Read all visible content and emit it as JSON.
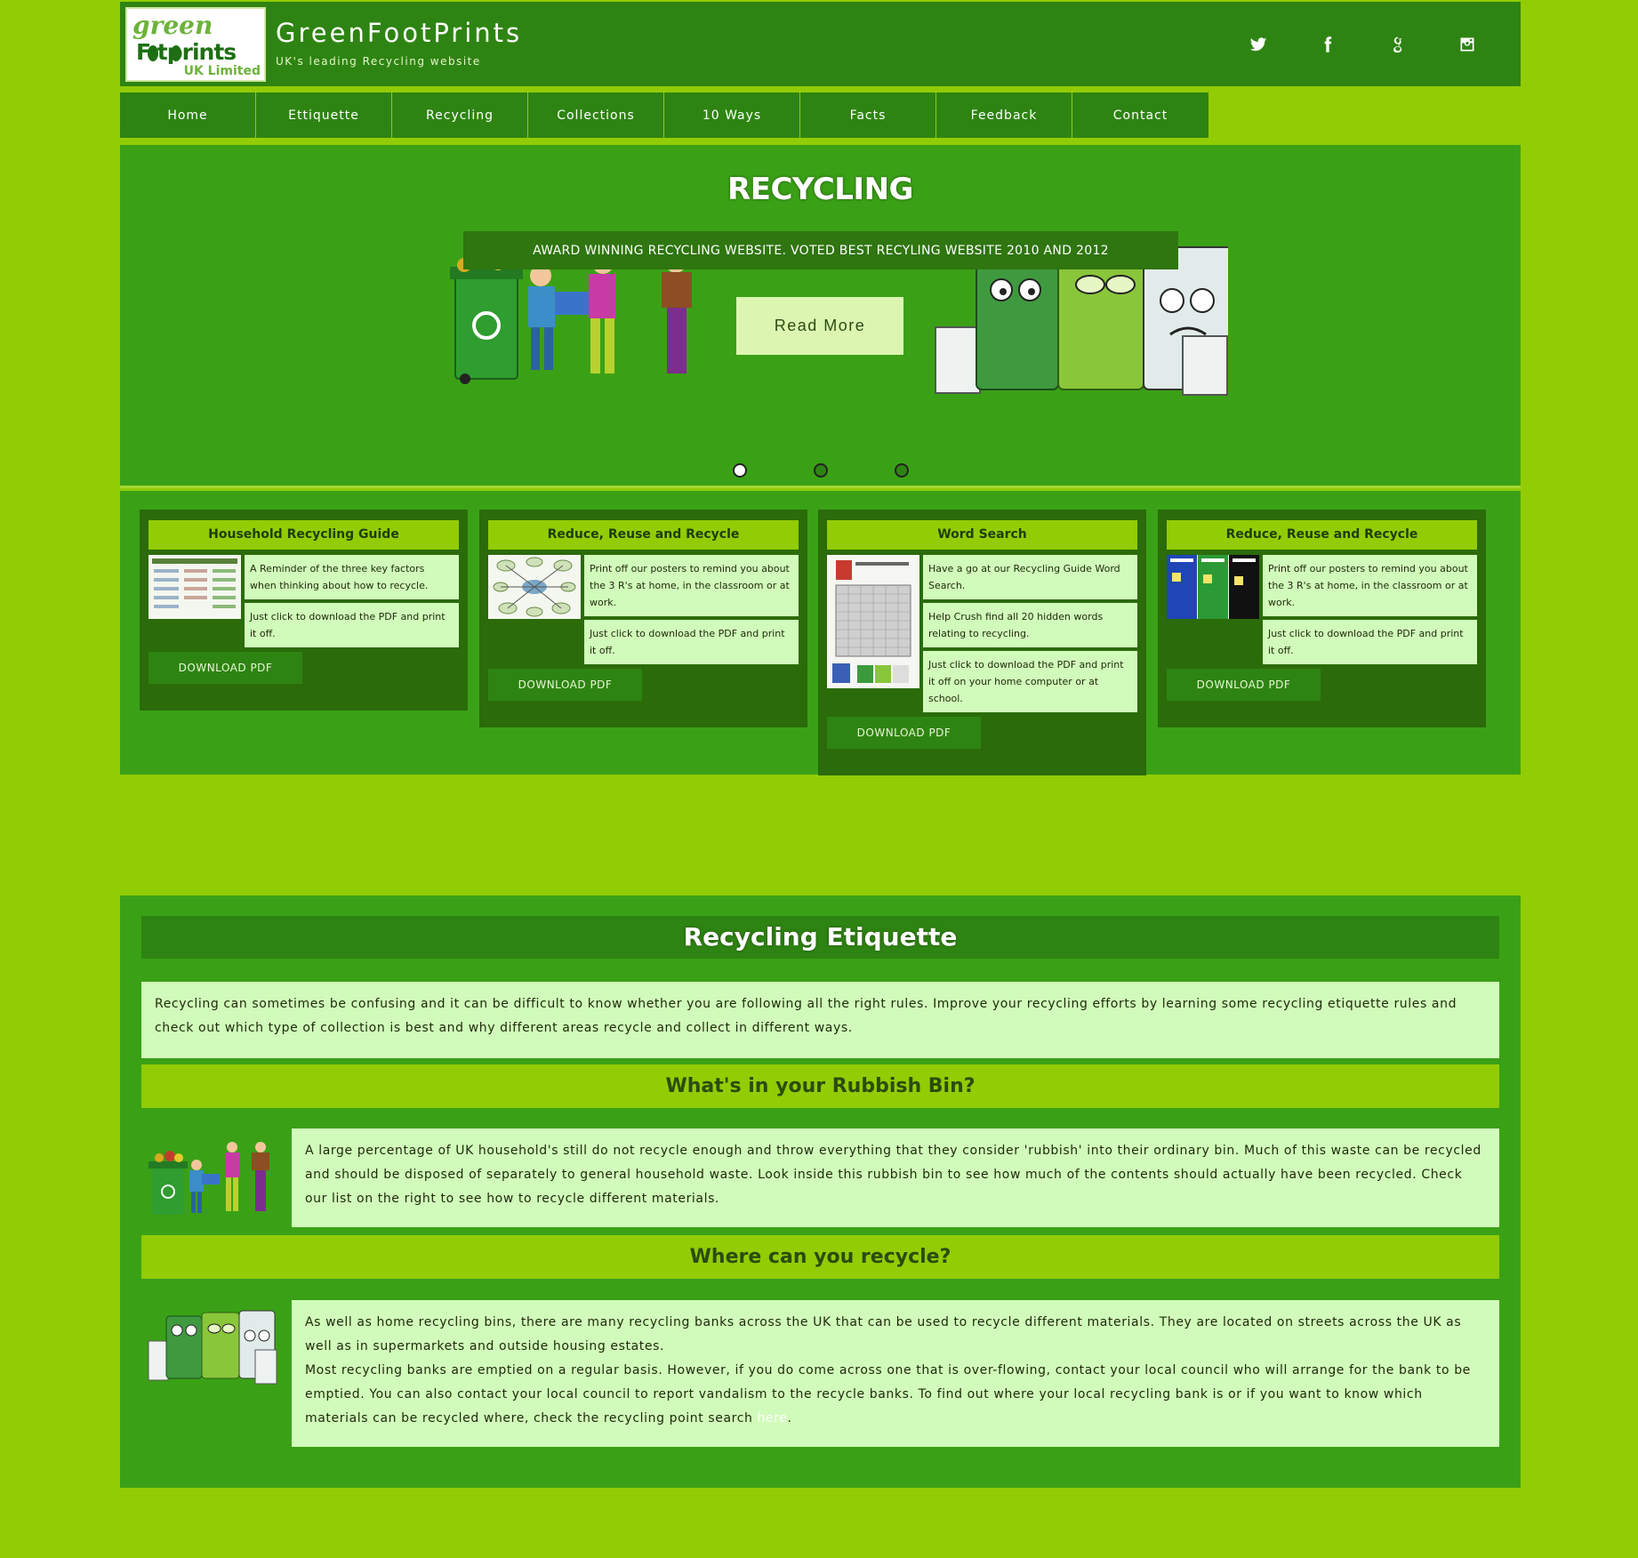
{
  "header": {
    "logo_top": "green",
    "logo_mid": "F  tprints",
    "logo_bottom": "UK Limited",
    "title": "GreenFootPrints",
    "subtitle": "UK's leading Recycling website",
    "social_icons": [
      "twitter-icon",
      "facebook-icon",
      "google-icon",
      "instagram-icon"
    ]
  },
  "nav": {
    "items": [
      "Home",
      "Ettiquette",
      "Recycling",
      "Collections",
      "10 Ways",
      "Facts",
      "Feedback",
      "Contact"
    ]
  },
  "hero": {
    "title": "RECYCLING",
    "banner": "AWARD WINNING RECYCLING WEBSITE. VOTED BEST RECYLING WEBSITE 2010 AND 2012",
    "button": "Read More",
    "active_slide": 1,
    "slide_count": 3
  },
  "cards": [
    {
      "title": "Household Recycling Guide",
      "texts": [
        "A Reminder of the three key factors when thinking about how to recycle.",
        "Just click to download the PDF and print it off."
      ],
      "button": "DOWNLOAD PDF"
    },
    {
      "title": "Reduce, Reuse and Recycle",
      "texts": [
        "Print off our posters to remind you about the 3 R's at home, in the classroom or at work.",
        "Just click to download the PDF and print it off."
      ],
      "button": "DOWNLOAD PDF"
    },
    {
      "title": "Word Search",
      "texts": [
        "Have a go at our Recycling Guide Word Search.",
        "Help Crush find all 20 hidden words relating to recycling.",
        "Just click to download the PDF and print it off on your home computer or at school."
      ],
      "button": "DOWNLOAD PDF"
    },
    {
      "title": "Reduce, Reuse and Recycle",
      "texts": [
        "Print off our posters to remind you about the 3 R's at home, in the classroom or at work.",
        "Just click to download the PDF and print it off."
      ],
      "button": "DOWNLOAD PDF"
    }
  ],
  "etiquette": {
    "title": "Recycling Etiquette",
    "intro": "Recycling can sometimes be confusing and it can be difficult to know whether you are following all the right rules. Improve your recycling efforts by learning some recycling etiquette rules and check out which type of collection is best and why different areas recycle and collect in different ways.",
    "rubbish_heading": "What's in your Rubbish Bin?",
    "rubbish_text": "A large percentage of UK household's still do not recycle enough and throw everything that they consider 'rubbish' into their ordinary bin. Much of this waste can be recycled and should be disposed of separately to general household waste. Look inside this rubbish bin to see how much of the contents should actually have been recycled. Check our list on the right to see how to recycle different materials.",
    "where_heading": "Where can you recycle?",
    "where_text_1": "As well as home recycling bins, there are many recycling banks across the UK that can be used to recycle different materials. They are located on streets across the UK as well as in supermarkets and outside housing estates.",
    "where_text_2": "Most recycling banks are emptied on a regular basis. However, if you do come across one that is over-flowing, contact your local council who will arrange for the bank to be emptied. You can also contact your local council to report vandalism to the recycle banks. To find out where your local recycling bank is or if you want to know which materials can be recycled where, check the recycling point search",
    "here_link": "here",
    "end_punct": "."
  },
  "colors": {
    "page_bg": "#92cc04",
    "dark_green": "#2e8412",
    "mid_green": "#3aa116",
    "pale_green": "#d1fbbb",
    "card_bg": "#2b6b0a"
  }
}
